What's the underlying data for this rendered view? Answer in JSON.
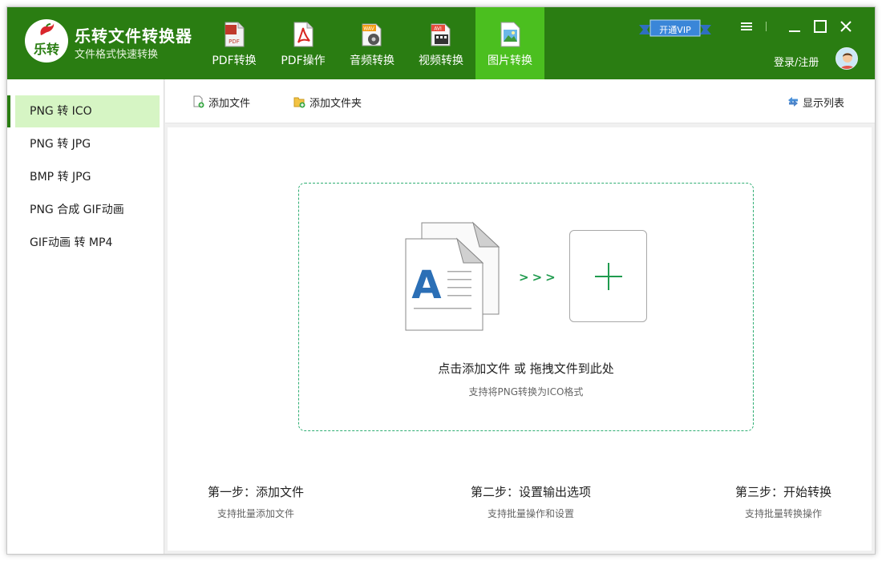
{
  "app": {
    "brand_title": "乐转文件转换器",
    "brand_subtitle": "文件格式快速转换",
    "logo_text": "乐转"
  },
  "nav": {
    "tabs": [
      {
        "label": "PDF转换",
        "icon": "pdf-file-icon",
        "active": false
      },
      {
        "label": "PDF操作",
        "icon": "pdf-acrobat-icon",
        "active": false
      },
      {
        "label": "音频转换",
        "icon": "wav-audio-icon",
        "active": false
      },
      {
        "label": "视频转换",
        "icon": "avi-video-icon",
        "active": false
      },
      {
        "label": "图片转换",
        "icon": "image-file-icon",
        "active": true
      }
    ]
  },
  "header": {
    "vip_label": "开通VIP",
    "login_label": "登录/注册"
  },
  "sidebar": {
    "items": [
      {
        "label": "PNG 转 ICO",
        "active": true
      },
      {
        "label": "PNG 转 JPG",
        "active": false
      },
      {
        "label": "BMP 转 JPG",
        "active": false
      },
      {
        "label": "PNG 合成 GIF动画",
        "active": false
      },
      {
        "label": "GIF动画 转 MP4",
        "active": false
      }
    ]
  },
  "toolbar": {
    "add_file": "添加文件",
    "add_folder": "添加文件夹",
    "show_list": "显示列表"
  },
  "dropzone": {
    "arrows": ">>>",
    "title": "点击添加文件 或 拖拽文件到此处",
    "subtitle": "支持将PNG转换为ICO格式"
  },
  "steps": [
    {
      "title": "第一步：添加文件",
      "subtitle": "支持批量添加文件"
    },
    {
      "title": "第二步：设置输出选项",
      "subtitle": "支持批量操作和设置"
    },
    {
      "title": "第三步：开始转换",
      "subtitle": "支持批量转换操作"
    }
  ],
  "colors": {
    "header_green": "#2a7d12",
    "active_tab": "#4bbf1f",
    "sidebar_active": "#d6f5c4",
    "accent_green": "#1f9b4e",
    "vip_blue": "#3a86d8"
  }
}
